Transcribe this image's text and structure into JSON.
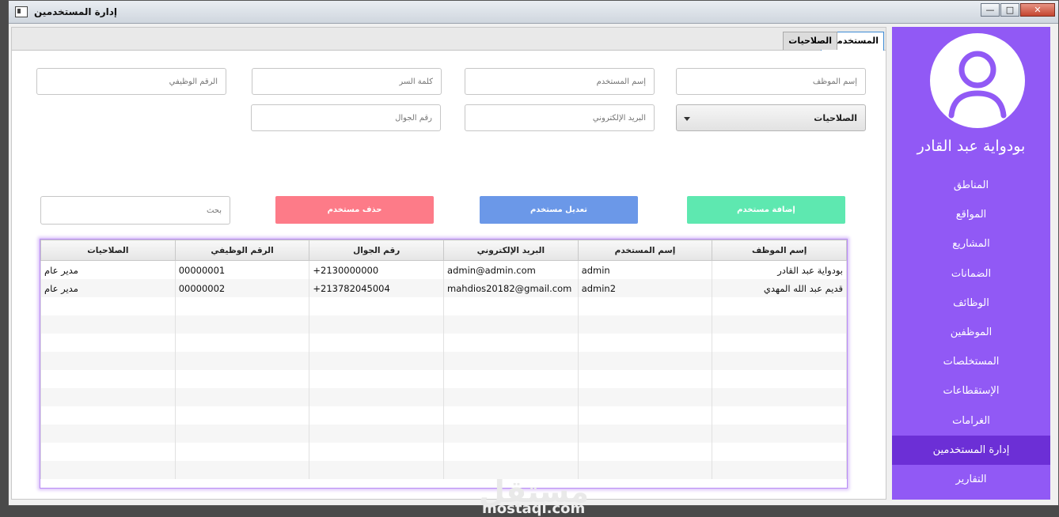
{
  "window": {
    "title": "إدارة المستخدمين"
  },
  "sidebar": {
    "user_name": "بودواية عبد القادر",
    "items": [
      {
        "label": "المناطق",
        "active": false
      },
      {
        "label": "المواقع",
        "active": false
      },
      {
        "label": "المشاريع",
        "active": false
      },
      {
        "label": "الضمانات",
        "active": false
      },
      {
        "label": "الوظائف",
        "active": false
      },
      {
        "label": "الموظفين",
        "active": false
      },
      {
        "label": "المستخلصات",
        "active": false
      },
      {
        "label": "الإستقطاعات",
        "active": false
      },
      {
        "label": "الغرامات",
        "active": false
      },
      {
        "label": "إدارة المستخدمين",
        "active": true
      },
      {
        "label": "التقارير",
        "active": false
      }
    ]
  },
  "tabs": {
    "users": "المستخدمين",
    "permissions": "الصلاحيات"
  },
  "form": {
    "employee_name_placeholder": "إسم الموظف",
    "username_placeholder": "إسم المستخدم",
    "password_placeholder": "كلمة السر",
    "job_number_placeholder": "الرقم الوظيفي",
    "email_placeholder": "البريد الإلكتروني",
    "phone_placeholder": "رقم الجوال",
    "permissions_select": "الصلاحيات"
  },
  "actions": {
    "add_user": "إضافة مستخدم",
    "edit_user": "تعديل مستخدم",
    "delete_user": "حذف مستخدم",
    "search_placeholder": "بحث"
  },
  "colors": {
    "sidebar": "#9159f5",
    "sidebar_active": "#6c2fd6",
    "add": "#5ee8b0",
    "edit": "#6b98e8",
    "delete": "#fd7b88"
  },
  "table": {
    "headers": [
      "إسم الموظف",
      "إسم المستخدم",
      "البريد الإلكتروني",
      "رقم الجوال",
      "الرقم الوظيفي",
      "الصلاحيات"
    ],
    "rows": [
      [
        "بودواية عبد القادر",
        "admin",
        "admin@admin.com",
        "+2130000000",
        "00000001",
        "مدير عام"
      ],
      [
        "قديم عبد الله المهدي",
        "admin2",
        "mahdios20182@gmail.com",
        "+213782045004",
        "00000002",
        "مدير عام"
      ]
    ]
  },
  "watermark": {
    "brand": "مستقل",
    "domain": "mostaql.com"
  }
}
